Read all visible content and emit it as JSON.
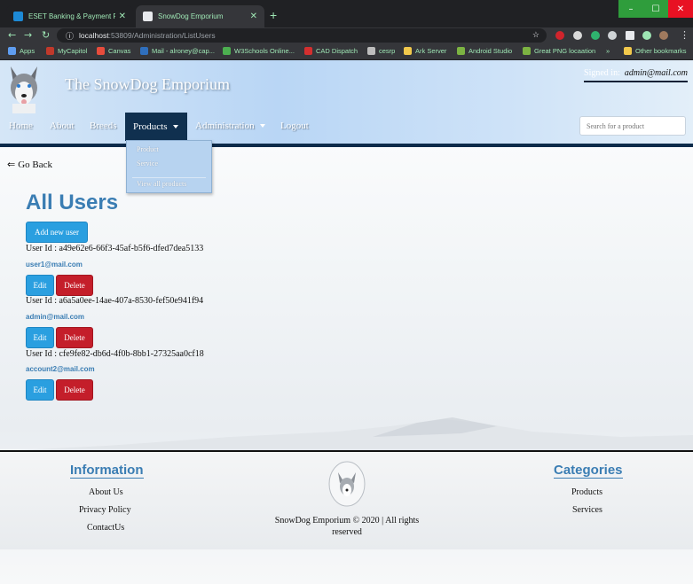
{
  "browser": {
    "tabs": [
      {
        "title": "ESET Banking & Payment Protect",
        "active": false
      },
      {
        "title": "SnowDog Emporium",
        "active": true
      }
    ],
    "url_host": "localhost",
    "url_path": ":53809/Administration/ListUsers",
    "bookmarks": [
      "Apps",
      "MyCapitol",
      "Canvas",
      "Mail - alroney@cap...",
      "W3Schools Online...",
      "CAD Dispatch",
      "cesrp",
      "Ark Server",
      "Android Studio",
      "Great PNG locaation",
      "Other bookmarks"
    ],
    "overflow": "»",
    "accent": "#9ee6b4"
  },
  "site": {
    "title": "The SnowDog Emporium",
    "signed_in_label": "Signed in:",
    "signed_in_user": "admin@mail.com",
    "search_placeholder": "Search for a product"
  },
  "nav": {
    "home": "Home",
    "about": "About",
    "breeds": "Breeds",
    "products": "Products",
    "administration": "Administration",
    "logout": "Logout"
  },
  "products_menu": {
    "product": "Product",
    "service": "Service",
    "view_all": "View all products"
  },
  "main": {
    "go_back": "Go Back",
    "title": "All Users",
    "add_button": "Add new user",
    "edit_label": "Edit",
    "delete_label": "Delete",
    "users": [
      {
        "id_text": "User Id : a49e62e6-66f3-45af-b5f6-dfed7dea5133",
        "email": "user1@mail.com"
      },
      {
        "id_text": "User Id : a6a5a0ee-14ae-407a-8530-fef50e941f94",
        "email": "admin@mail.com"
      },
      {
        "id_text": "User Id : cfe9fe82-db6d-4f0b-8bb1-27325aa0cf18",
        "email": "account2@mail.com"
      }
    ]
  },
  "footer": {
    "information_heading": "Information",
    "about_us": "About Us",
    "privacy_policy": "Privacy Policy",
    "contact_us": "ContactUs",
    "categories_heading": "Categories",
    "products": "Products",
    "services": "Services",
    "copyright": "SnowDog Emporium © 2020 | All rights reserved"
  },
  "colors": {
    "heading_blue": "#3a7db3",
    "button_blue": "#2a9fe0",
    "button_red": "#c41e2a",
    "nav_dark": "#10304f"
  }
}
